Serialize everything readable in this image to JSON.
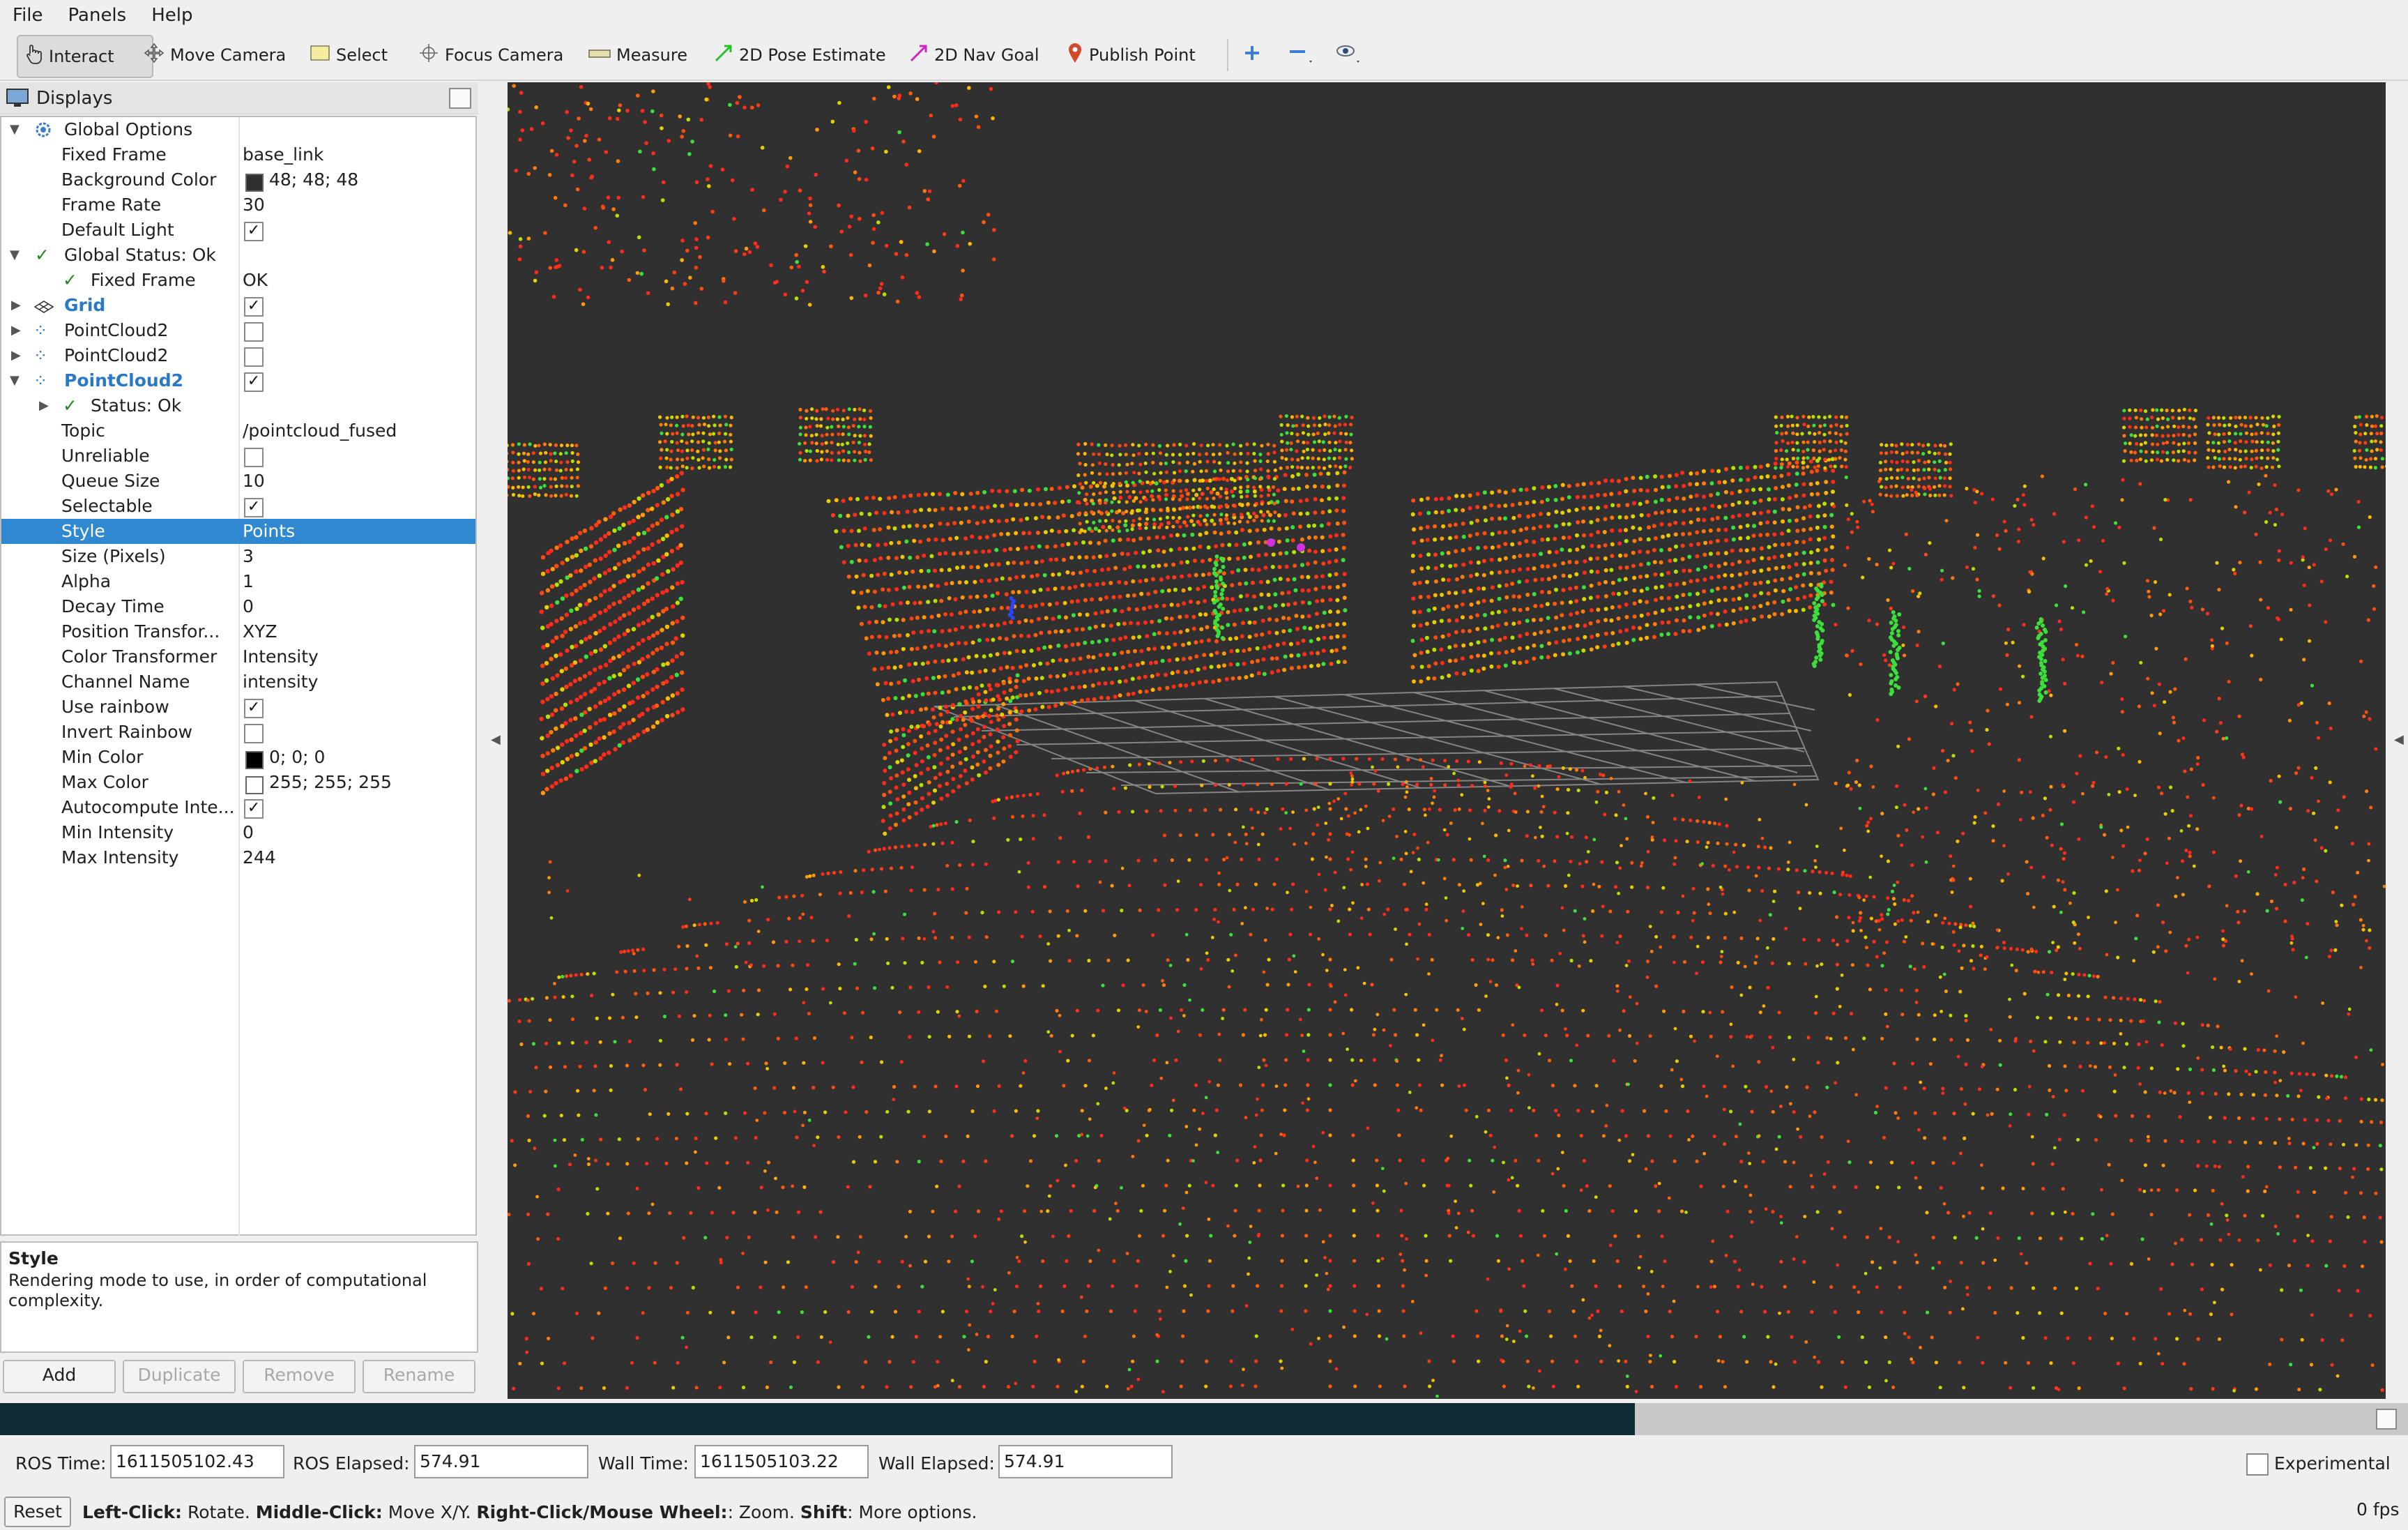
{
  "menubar": {
    "items": [
      "File",
      "Panels",
      "Help"
    ]
  },
  "toolbar": {
    "interact": "Interact",
    "move_camera": "Move Camera",
    "select": "Select",
    "focus_camera": "Focus Camera",
    "measure": "Measure",
    "pose_estimate": "2D Pose Estimate",
    "nav_goal": "2D Nav Goal",
    "publish_point": "Publish Point",
    "accent_pose": "#22c522",
    "accent_nav": "#d022c8",
    "accent_publish": "#d24a2a"
  },
  "displays": {
    "title": "Displays",
    "rows": [
      {
        "label": "Global Options",
        "value": ""
      },
      {
        "label": "Fixed Frame",
        "value": "base_link"
      },
      {
        "label": "Background Color",
        "value": "48; 48; 48"
      },
      {
        "label": "Frame Rate",
        "value": "30"
      },
      {
        "label": "Default Light",
        "value": ""
      },
      {
        "label": "Global Status: Ok",
        "value": ""
      },
      {
        "label": "Fixed Frame",
        "value": "OK"
      },
      {
        "label": "Grid",
        "value": ""
      },
      {
        "label": "PointCloud2",
        "value": ""
      },
      {
        "label": "PointCloud2",
        "value": ""
      },
      {
        "label": "PointCloud2",
        "value": ""
      },
      {
        "label": "Status: Ok",
        "value": ""
      },
      {
        "label": "Topic",
        "value": "/pointcloud_fused"
      },
      {
        "label": "Unreliable",
        "value": ""
      },
      {
        "label": "Queue Size",
        "value": "10"
      },
      {
        "label": "Selectable",
        "value": ""
      },
      {
        "label": "Style",
        "value": "Points"
      },
      {
        "label": "Size (Pixels)",
        "value": "3"
      },
      {
        "label": "Alpha",
        "value": "1"
      },
      {
        "label": "Decay Time",
        "value": "0"
      },
      {
        "label": "Position Transfor...",
        "value": "XYZ"
      },
      {
        "label": "Color Transformer",
        "value": "Intensity"
      },
      {
        "label": "Channel Name",
        "value": "intensity"
      },
      {
        "label": "Use rainbow",
        "value": ""
      },
      {
        "label": "Invert Rainbow",
        "value": ""
      },
      {
        "label": "Min Color",
        "value": "0; 0; 0"
      },
      {
        "label": "Max Color",
        "value": "255; 255; 255"
      },
      {
        "label": "Autocompute Inte...",
        "value": ""
      },
      {
        "label": "Min Intensity",
        "value": "0"
      },
      {
        "label": "Max Intensity",
        "value": "244"
      }
    ],
    "checkboxes": {
      "default_light": true,
      "grid": true,
      "pointcloud_1": false,
      "pointcloud_2": false,
      "pointcloud_3": true,
      "unreliable": false,
      "selectable": true,
      "use_rainbow": true,
      "invert_rainbow": false,
      "autocompute": true
    },
    "colors": {
      "background": "#303030",
      "min_color": "#000000",
      "max_color": "#ffffff",
      "selection": "#3089d0"
    }
  },
  "help": {
    "title": "Style",
    "text": "Rendering mode to use, in order of computational complexity."
  },
  "panel_buttons": {
    "add": "Add",
    "duplicate": "Duplicate",
    "remove": "Remove",
    "rename": "Rename"
  },
  "progress": {
    "fraction": 0.679
  },
  "timebar": {
    "ros_time_label": "ROS Time:",
    "ros_time": "1611505102.43",
    "ros_elapsed_label": "ROS Elapsed:",
    "ros_elapsed": "574.91",
    "wall_time_label": "Wall Time:",
    "wall_time": "1611505103.22",
    "wall_elapsed_label": "Wall Elapsed:",
    "wall_elapsed": "574.91",
    "experimental": "Experimental"
  },
  "statusbar": {
    "reset": "Reset",
    "left_click_key": "Left-Click:",
    "left_click": " Rotate. ",
    "middle_click_key": "Middle-Click:",
    "middle_click": " Move X/Y. ",
    "right_click_key": "Right-Click/Mouse Wheel:",
    "right_click": ": Zoom. ",
    "shift_key": "Shift",
    "shift": ": More options.",
    "fps": "0 fps"
  }
}
